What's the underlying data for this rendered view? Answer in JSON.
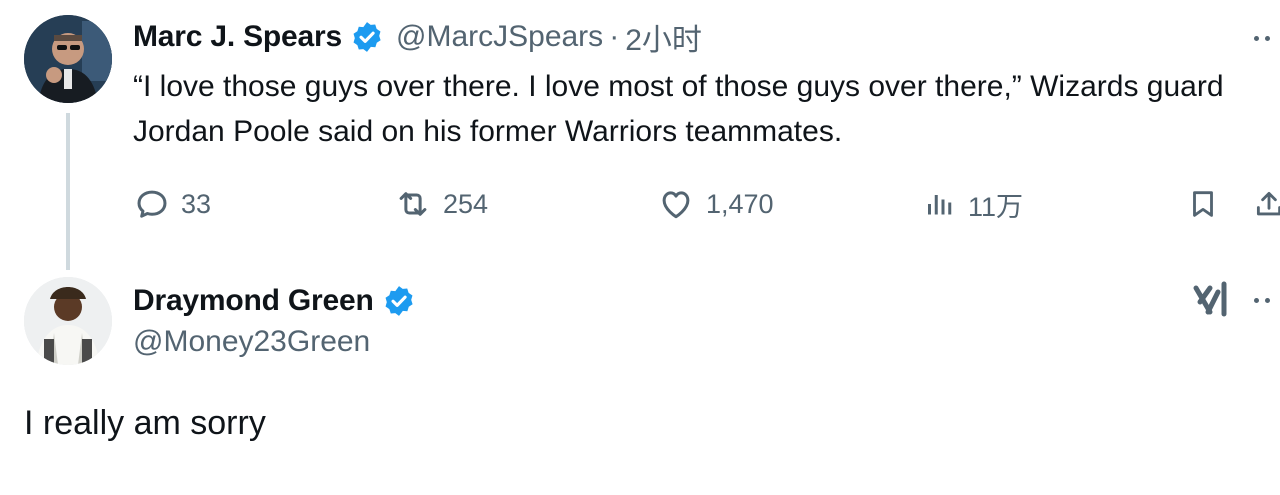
{
  "tweet": {
    "author_name": "Marc J. Spears",
    "handle": "@MarcJSpears",
    "separator": "·",
    "time": "2小时",
    "text": "“I love those guys over there. I love most of those guys over there,” Wizards guard Jordan Poole  said on his former Warriors teammates.",
    "verified_color": "#1d9bf0",
    "actions": {
      "replies": "33",
      "retweets": "254",
      "likes": "1,470",
      "views": "11万"
    }
  },
  "reply": {
    "author_name": "Draymond Green",
    "handle": "@Money23Green",
    "text": "I really am sorry",
    "verified_color": "#1d9bf0"
  },
  "icons": {
    "reply": "comment-bubble-icon",
    "retweet": "retweet-arrows-icon",
    "like": "heart-icon",
    "views": "bar-chart-icon",
    "bookmark": "bookmark-icon",
    "share": "share-upload-icon",
    "more": "more-horizontal-icon",
    "grok": "grok-x-icon",
    "verified": "verified-badge-icon"
  },
  "colors": {
    "text_primary": "#0f1419",
    "text_secondary": "#536471",
    "thread_line": "#cfd9de"
  }
}
